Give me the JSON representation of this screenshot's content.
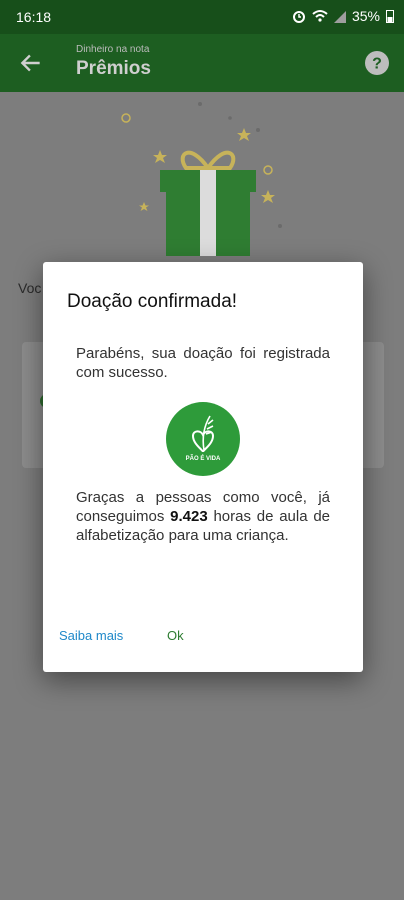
{
  "status_bar": {
    "time": "16:18",
    "battery": "35%",
    "icons": [
      "alarm-icon",
      "wifi-icon",
      "signal-icon",
      "battery-icon"
    ]
  },
  "app_bar": {
    "subtitle": "Dinheiro na nota",
    "title": "Prêmios",
    "icons": [
      "back-arrow-icon",
      "help-icon"
    ]
  },
  "background": {
    "text_fragment": "Voc"
  },
  "dialog": {
    "title": "Doação confirmada!",
    "paragraph1": "Parabéns, sua doação foi registrada com sucesso.",
    "logo_text": "PÃO É VIDA",
    "paragraph2_before": "Graças a pessoas como você, já conseguimos ",
    "paragraph2_number": "9.423",
    "paragraph2_after": " horas de aula de alfabetização para uma criança.",
    "more_label": "Saiba mais",
    "ok_label": "Ok"
  },
  "colors": {
    "app_bar": "#1d5e21",
    "status_bar": "#174f1a",
    "logo_green": "#2e9b3a",
    "link_blue": "#1e88c9",
    "ok_green": "#2e7d32"
  }
}
